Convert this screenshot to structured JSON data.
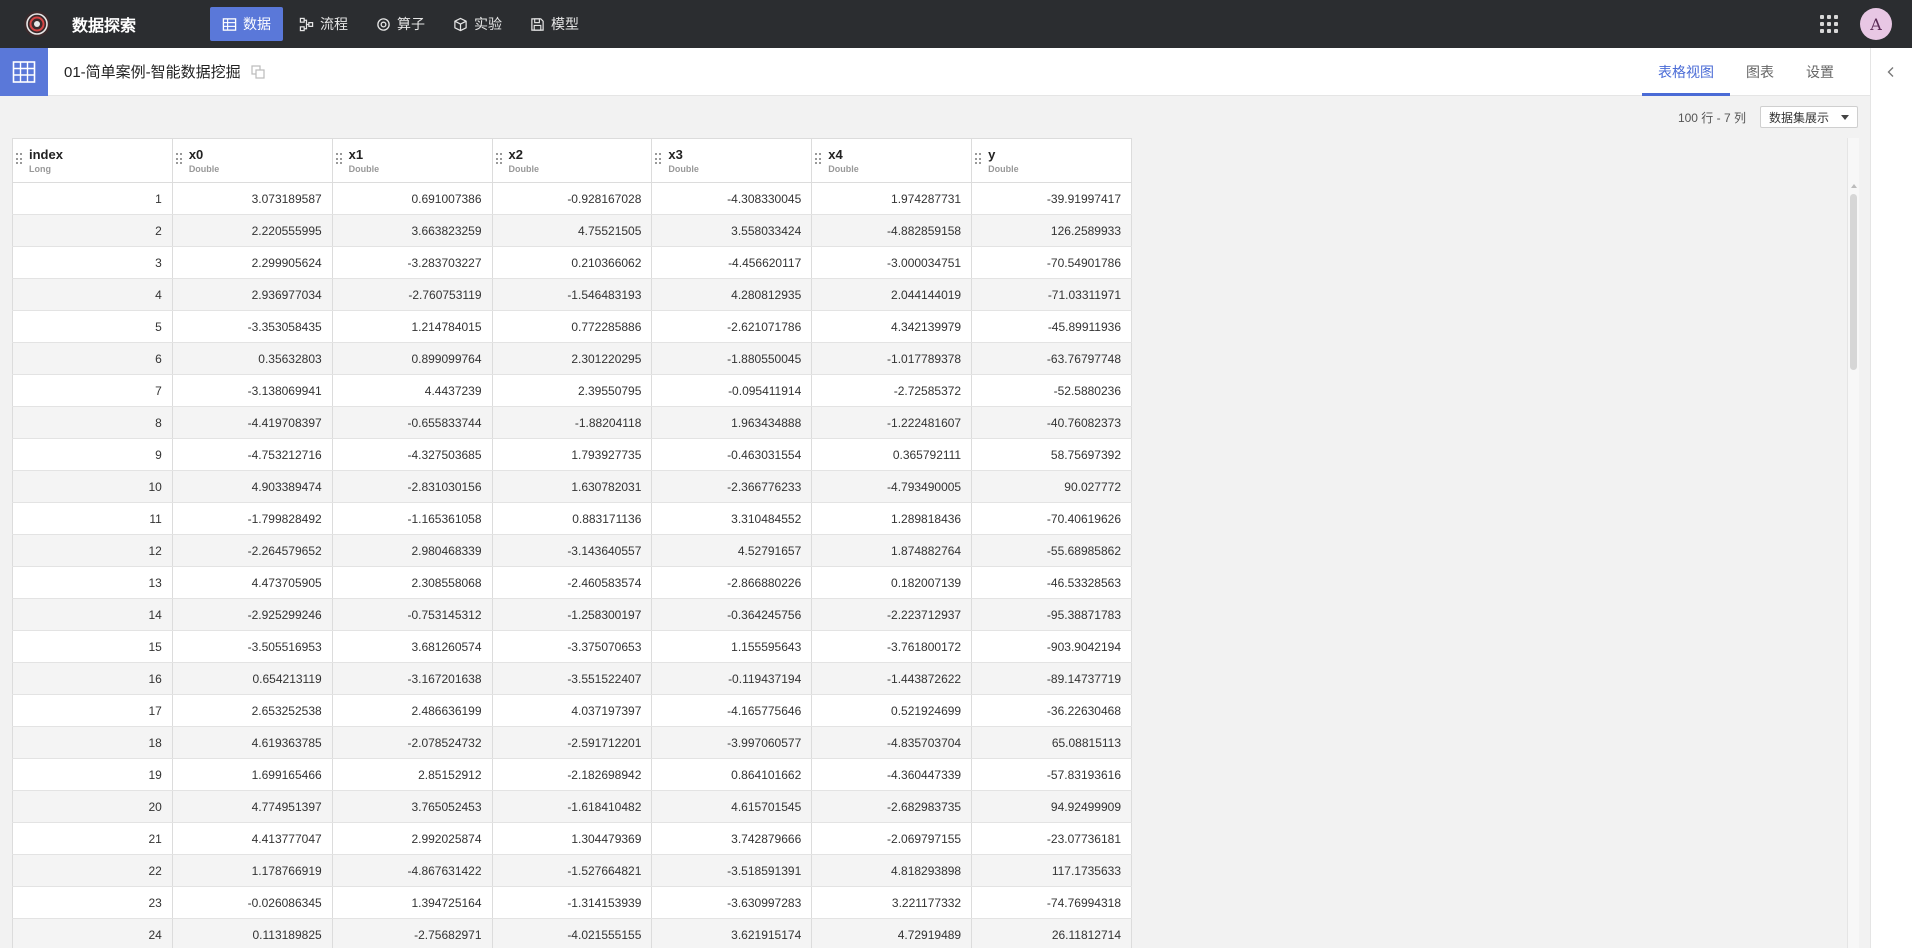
{
  "app": {
    "title": "数据探索",
    "nav": [
      {
        "label": "数据",
        "icon": "table-icon",
        "active": true
      },
      {
        "label": "流程",
        "icon": "flow-icon",
        "active": false
      },
      {
        "label": "算子",
        "icon": "operator-icon",
        "active": false
      },
      {
        "label": "实验",
        "icon": "experiment-cube-icon",
        "active": false
      },
      {
        "label": "模型",
        "icon": "model-save-icon",
        "active": false
      }
    ],
    "avatar_letter": "A",
    "accent_color": "#5a78d9"
  },
  "dataset": {
    "title": "01-简单案例-智能数据挖掘",
    "tabs": [
      {
        "label": "表格视图",
        "active": true
      },
      {
        "label": "图表",
        "active": false
      },
      {
        "label": "设置",
        "active": false
      }
    ],
    "row_info": "100 行 - 7 列",
    "display_select": "数据集展示"
  },
  "table": {
    "columns": [
      {
        "name": "index",
        "type": "Long"
      },
      {
        "name": "x0",
        "type": "Double"
      },
      {
        "name": "x1",
        "type": "Double"
      },
      {
        "name": "x2",
        "type": "Double"
      },
      {
        "name": "x3",
        "type": "Double"
      },
      {
        "name": "x4",
        "type": "Double"
      },
      {
        "name": "y",
        "type": "Double"
      }
    ],
    "rows": [
      [
        "1",
        "3.073189587",
        "0.691007386",
        "-0.928167028",
        "-4.308330045",
        "1.974287731",
        "-39.91997417"
      ],
      [
        "2",
        "2.220555995",
        "3.663823259",
        "4.75521505",
        "3.558033424",
        "-4.882859158",
        "126.2589933"
      ],
      [
        "3",
        "2.299905624",
        "-3.283703227",
        "0.210366062",
        "-4.456620117",
        "-3.000034751",
        "-70.54901786"
      ],
      [
        "4",
        "2.936977034",
        "-2.760753119",
        "-1.546483193",
        "4.280812935",
        "2.044144019",
        "-71.03311971"
      ],
      [
        "5",
        "-3.353058435",
        "1.214784015",
        "0.772285886",
        "-2.621071786",
        "4.342139979",
        "-45.89911936"
      ],
      [
        "6",
        "0.35632803",
        "0.899099764",
        "2.301220295",
        "-1.880550045",
        "-1.017789378",
        "-63.76797748"
      ],
      [
        "7",
        "-3.138069941",
        "4.4437239",
        "2.39550795",
        "-0.095411914",
        "-2.72585372",
        "-52.5880236"
      ],
      [
        "8",
        "-4.419708397",
        "-0.655833744",
        "-1.88204118",
        "1.963434888",
        "-1.222481607",
        "-40.76082373"
      ],
      [
        "9",
        "-4.753212716",
        "-4.327503685",
        "1.793927735",
        "-0.463031554",
        "0.365792111",
        "58.75697392"
      ],
      [
        "10",
        "4.903389474",
        "-2.831030156",
        "1.630782031",
        "-2.366776233",
        "-4.793490005",
        "90.027772"
      ],
      [
        "11",
        "-1.799828492",
        "-1.165361058",
        "0.883171136",
        "3.310484552",
        "1.289818436",
        "-70.40619626"
      ],
      [
        "12",
        "-2.264579652",
        "2.980468339",
        "-3.143640557",
        "4.52791657",
        "1.874882764",
        "-55.68985862"
      ],
      [
        "13",
        "4.473705905",
        "2.308558068",
        "-2.460583574",
        "-2.866880226",
        "0.182007139",
        "-46.53328563"
      ],
      [
        "14",
        "-2.925299246",
        "-0.753145312",
        "-1.258300197",
        "-0.364245756",
        "-2.223712937",
        "-95.38871783"
      ],
      [
        "15",
        "-3.505516953",
        "3.681260574",
        "-3.375070653",
        "1.155595643",
        "-3.761800172",
        "-903.9042194"
      ],
      [
        "16",
        "0.654213119",
        "-3.167201638",
        "-3.551522407",
        "-0.119437194",
        "-1.443872622",
        "-89.14737719"
      ],
      [
        "17",
        "2.653252538",
        "2.486636199",
        "4.037197397",
        "-4.165775646",
        "0.521924699",
        "-36.22630468"
      ],
      [
        "18",
        "4.619363785",
        "-2.078524732",
        "-2.591712201",
        "-3.997060577",
        "-4.835703704",
        "65.08815113"
      ],
      [
        "19",
        "1.699165466",
        "2.85152912",
        "-2.182698942",
        "0.864101662",
        "-4.360447339",
        "-57.83193616"
      ],
      [
        "20",
        "4.774951397",
        "3.765052453",
        "-1.618410482",
        "4.615701545",
        "-2.682983735",
        "94.92499909"
      ],
      [
        "21",
        "4.413777047",
        "2.992025874",
        "1.304479369",
        "3.742879666",
        "-2.069797155",
        "-23.07736181"
      ],
      [
        "22",
        "1.178766919",
        "-4.867631422",
        "-1.527664821",
        "-3.518591391",
        "4.818293898",
        "117.1735633"
      ],
      [
        "23",
        "-0.026086345",
        "1.394725164",
        "-1.314153939",
        "-3.630997283",
        "3.221177332",
        "-74.76994318"
      ],
      [
        "24",
        "0.113189825",
        "-2.75682971",
        "-4.021555155",
        "3.621915174",
        "4.72919489",
        "26.11812714"
      ]
    ]
  }
}
